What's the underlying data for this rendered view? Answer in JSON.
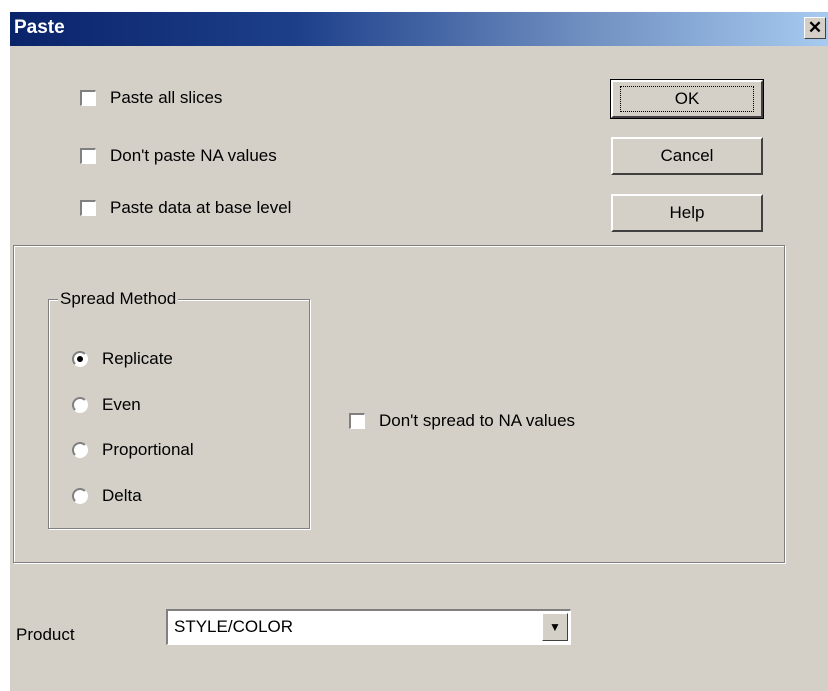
{
  "window": {
    "title": "Paste",
    "close_glyph": "✕"
  },
  "options": [
    {
      "label": "Paste all slices",
      "checked": false
    },
    {
      "label": "Don't paste NA values",
      "checked": false
    },
    {
      "label": "Paste data at base level",
      "checked": false
    }
  ],
  "buttons": {
    "ok": "OK",
    "cancel": "Cancel",
    "help": "Help"
  },
  "spread_method": {
    "title": "Spread Method",
    "options": [
      {
        "label": "Replicate",
        "selected": true
      },
      {
        "label": "Even",
        "selected": false
      },
      {
        "label": "Proportional",
        "selected": false
      },
      {
        "label": "Delta",
        "selected": false
      }
    ]
  },
  "spread_na": {
    "label": "Don't spread to NA values",
    "checked": false
  },
  "product": {
    "label": "Product",
    "value": "STYLE/COLOR",
    "arrow_icon": "chevron-down-icon"
  }
}
